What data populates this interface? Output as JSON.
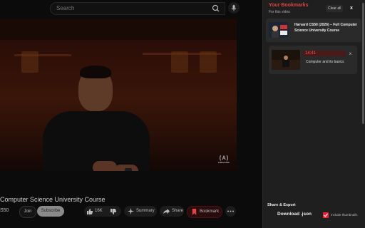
{
  "search": {
    "placeholder": "Search"
  },
  "video": {
    "title": "Computer Science University Course",
    "channel": "S50",
    "overlay_logo": "(A)",
    "overlay_logo_caption": "SUBSCRIBE"
  },
  "actions": {
    "join": "Join",
    "subscribe": "Subscribe",
    "likes": "16K",
    "summary": "Summary",
    "share": "Share",
    "bookmark": "Bookmark"
  },
  "panel": {
    "title": "Your Bookmarks",
    "subtitle": "For this video",
    "clear_all": "Clear all",
    "close": "x",
    "video_title": "Harvard CS50 (2026) – Full Computer Science University Course",
    "bookmarks": [
      {
        "time": "14:41",
        "title": "Computer and its basics",
        "remove": "x"
      }
    ],
    "share_export": "Share & Export",
    "download": "Download .json",
    "include_thumbnails": "Include thumbnails",
    "include_thumbnails_checked": true
  },
  "colors": {
    "accent": "#e04343",
    "panel_bg": "#1f1f1f"
  }
}
